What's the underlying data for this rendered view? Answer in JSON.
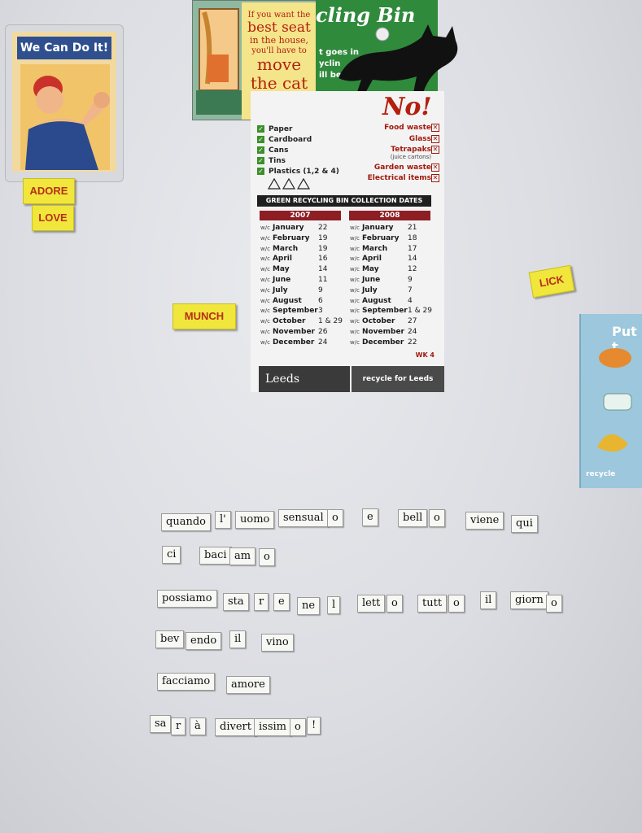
{
  "poster": {
    "banner": "We Can Do It!"
  },
  "magnets_yellow": {
    "adore": "ADORE",
    "love": "LOVE",
    "munch": "MUNCH",
    "lick": "LICK"
  },
  "cat_card": {
    "lines": [
      "If you want the",
      "best seat",
      "in the house,",
      "you'll have to",
      "move",
      "the cat"
    ]
  },
  "recycling_sheet": {
    "title_fragment": "cling Bin",
    "subtitle_lines": [
      "t goes in",
      "yclin",
      "ill be e"
    ],
    "no_label": "No!",
    "no_items": [
      "Food waste",
      "Glass",
      "Tetrapaks",
      "(juice cartons)",
      "Garden waste",
      "Electrical items"
    ],
    "yes_items": [
      "Paper",
      "Cardboard",
      "Cans",
      "Tins",
      "Plastics (1,2 & 4)"
    ],
    "table_title": "GREEN RECYCLING BIN COLLECTION DATES",
    "year_2007": "2007",
    "year_2008": "2008",
    "wc": "w/c",
    "months": [
      "January",
      "February",
      "March",
      "April",
      "May",
      "June",
      "July",
      "August",
      "September",
      "October",
      "November",
      "December"
    ],
    "dates_2007": [
      "22",
      "19",
      "19",
      "16",
      "14",
      "11",
      "9",
      "6",
      "3",
      "1 & 29",
      "26",
      "24"
    ],
    "dates_2008": [
      "21",
      "18",
      "17",
      "14",
      "12",
      "9",
      "7",
      "4",
      "1 & 29",
      "27",
      "24",
      "22"
    ],
    "wk": "WK 4",
    "footer_left": "Leeds",
    "footer_right": "recycle for Leeds"
  },
  "blue_card": {
    "put": "Put t",
    "recycle": "recycle"
  },
  "poem_lines": [
    [
      "quando",
      "l'",
      "uomo",
      "sensual",
      "o",
      "e",
      "bell",
      "o",
      "viene",
      "qui"
    ],
    [
      "ci",
      "baci",
      "am",
      "o"
    ],
    [
      "possiamo",
      "sta",
      "r",
      "e",
      "ne",
      "l",
      "lett",
      "o",
      "tutt",
      "o",
      "il",
      "giorn",
      "o"
    ],
    [
      "bev",
      "endo",
      "il",
      "vino"
    ],
    [
      "facciamo",
      "amore"
    ],
    [
      "sa",
      "r",
      "à",
      "divert",
      "issim",
      "o",
      "!"
    ]
  ],
  "colors": {
    "fridge": "#dcdde2",
    "recycle_green": "#2f8a3b",
    "no_red": "#b3200e",
    "tile_yellow": "#f1e63c",
    "calendar_maroon": "#8d1e24"
  }
}
